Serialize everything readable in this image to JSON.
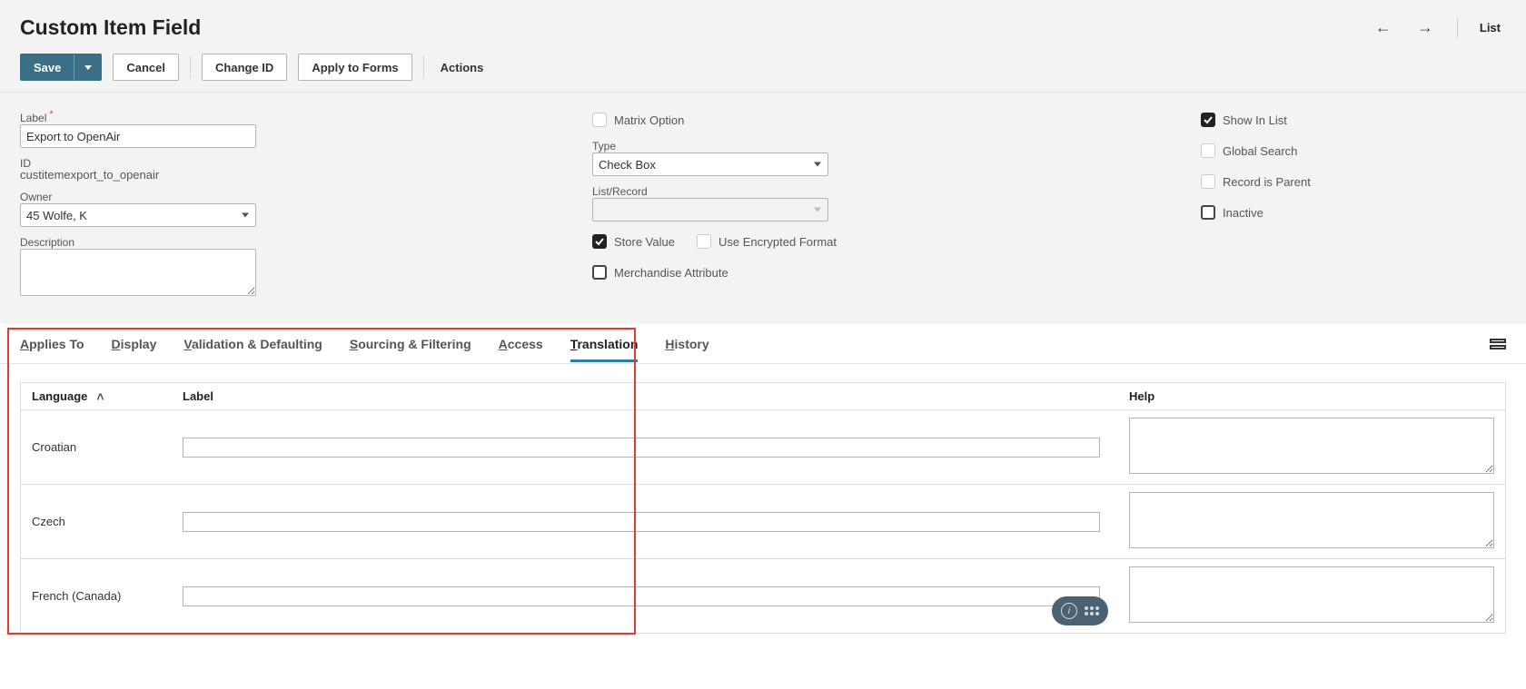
{
  "header": {
    "title": "Custom Item Field",
    "list_link": "List"
  },
  "actions": {
    "save": "Save",
    "cancel": "Cancel",
    "change_id": "Change ID",
    "apply_to_forms": "Apply to Forms",
    "actions": "Actions"
  },
  "form": {
    "label_field": {
      "label": "Label",
      "value": "Export to OpenAir"
    },
    "id_field": {
      "label": "ID",
      "value": "custitemexport_to_openair"
    },
    "owner_field": {
      "label": "Owner",
      "value": "45 Wolfe, K"
    },
    "description_field": {
      "label": "Description",
      "value": ""
    },
    "matrix_option": {
      "label": "Matrix Option",
      "checked": false
    },
    "type_field": {
      "label": "Type",
      "value": "Check Box"
    },
    "list_record_field": {
      "label": "List/Record",
      "value": ""
    },
    "store_value": {
      "label": "Store Value",
      "checked": true
    },
    "use_encrypted": {
      "label": "Use Encrypted Format",
      "checked": false
    },
    "merchandise_attr": {
      "label": "Merchandise Attribute",
      "checked": false
    },
    "show_in_list": {
      "label": "Show In List",
      "checked": true
    },
    "global_search": {
      "label": "Global Search",
      "checked": false
    },
    "record_is_parent": {
      "label": "Record is Parent",
      "checked": false
    },
    "inactive": {
      "label": "Inactive",
      "checked": false
    }
  },
  "tabs": {
    "applies_to": "pplies To",
    "applies_to_u": "A",
    "display": "isplay",
    "display_u": "D",
    "validation": "alidation & Defaulting",
    "validation_u": "V",
    "sourcing": "ourcing & Filtering",
    "sourcing_u": "S",
    "access": "ccess",
    "access_u": "A",
    "translation": "ranslation",
    "translation_u": "T",
    "history": "istory",
    "history_u": "H"
  },
  "translation_table": {
    "col_language": "Language",
    "col_label": "Label",
    "col_help": "Help",
    "rows": [
      {
        "language": "Croatian",
        "label": "",
        "help": ""
      },
      {
        "language": "Czech",
        "label": "",
        "help": ""
      },
      {
        "language": "French (Canada)",
        "label": "",
        "help": ""
      }
    ]
  }
}
